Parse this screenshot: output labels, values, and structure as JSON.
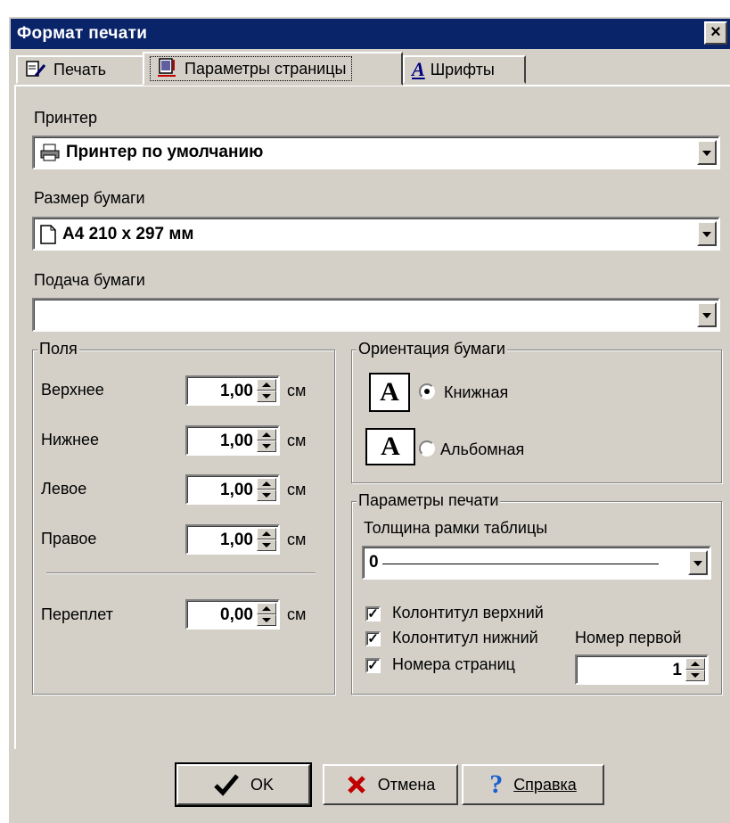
{
  "window": {
    "title": "Формат печати",
    "close_label": "×"
  },
  "tabs": [
    {
      "label": "Печать",
      "icon": "print-doc-icon"
    },
    {
      "label": "Параметры страницы",
      "icon": "page-setup-icon"
    },
    {
      "label": "Шрифты",
      "icon": "font-icon",
      "icon_text": "A"
    }
  ],
  "printer": {
    "label": "Принтер",
    "value": "Принтер по умолчанию"
  },
  "paper_size": {
    "label": "Размер бумаги",
    "value": "A4 210 x 297 мм"
  },
  "paper_source": {
    "label": "Подача бумаги",
    "value": ""
  },
  "margins": {
    "title": "Поля",
    "unit": "см",
    "top": {
      "label": "Верхнее",
      "value": "1,00"
    },
    "bottom": {
      "label": "Нижнее",
      "value": "1,00"
    },
    "left": {
      "label": "Левое",
      "value": "1,00"
    },
    "right": {
      "label": "Правое",
      "value": "1,00"
    },
    "gutter": {
      "label": "Переплет",
      "value": "0,00"
    }
  },
  "orientation": {
    "title": "Ориентация бумаги",
    "icon_letter": "A",
    "portrait": "Книжная",
    "landscape": "Альбомная",
    "selected": "portrait"
  },
  "print_params": {
    "title": "Параметры печати",
    "frame_label": "Толщина рамки таблицы",
    "frame_value": "0",
    "header": {
      "label": "Колонтитул верхний",
      "checked": true
    },
    "footer": {
      "label": "Колонтитул нижний",
      "checked": true
    },
    "page_numbers": {
      "label": "Номера страниц",
      "checked": true
    },
    "first_number_label": "Номер первой",
    "first_number_value": "1"
  },
  "buttons": {
    "ok": "OK",
    "cancel": "Отмена",
    "help": "Справка"
  },
  "check_mark": "✓"
}
